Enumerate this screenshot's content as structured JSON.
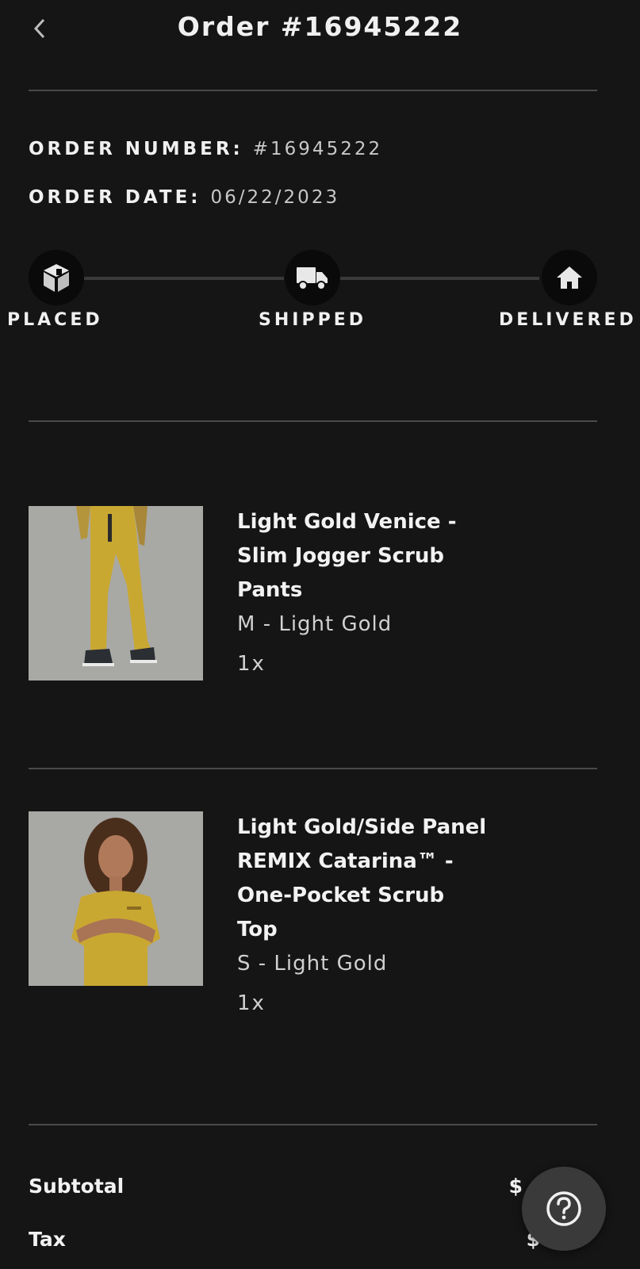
{
  "header": {
    "title": "Order #16945222",
    "back_icon": "chevron-left-icon"
  },
  "order": {
    "number_label": "ORDER NUMBER:",
    "number_value": "#16945222",
    "date_label": "ORDER DATE:",
    "date_value": "06/22/2023"
  },
  "progress": {
    "steps": [
      {
        "label": "PLACED",
        "icon": "package-icon"
      },
      {
        "label": "SHIPPED",
        "icon": "truck-icon"
      },
      {
        "label": "DELIVERED",
        "icon": "house-icon"
      }
    ]
  },
  "items": [
    {
      "title": "Light Gold Venice - Slim Jogger Scrub Pants",
      "variant": "M - Light Gold",
      "quantity": "1x",
      "image": "product-photo-jogger-pants"
    },
    {
      "title": "Light Gold/Side Panel REMIX Catarina™ - One-Pocket Scrub Top",
      "variant": "S - Light Gold",
      "quantity": "1x",
      "image": "product-photo-scrub-top"
    }
  ],
  "summary": {
    "subtotal_label": "Subtotal",
    "subtotal_value": "$",
    "tax_label": "Tax",
    "tax_value": "$"
  },
  "help": {
    "icon": "question-circle-icon"
  },
  "colors": {
    "background": "#151515",
    "divider": "#4a4a4a",
    "product_color": "#c9a832",
    "help_button": "#3a3a3a"
  }
}
